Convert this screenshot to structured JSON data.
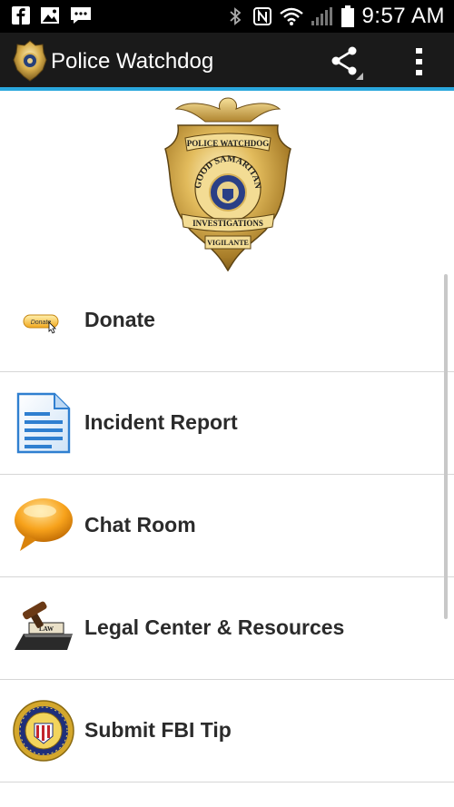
{
  "status_bar": {
    "time": "9:57 AM",
    "left_icons": [
      "facebook-icon",
      "gallery-icon",
      "chat-notification-icon"
    ],
    "right_icons": [
      "bluetooth-icon",
      "nfc-icon",
      "wifi-icon",
      "cell-signal-icon",
      "battery-icon"
    ]
  },
  "action_bar": {
    "title": "Police Watchdog",
    "share_icon": "share-icon",
    "overflow_icon": "overflow-menu-icon",
    "accent_color": "#2aa7dd"
  },
  "badge": {
    "top_text": "POLICE WATCHDOG",
    "arc_text": "GOOD SAMARITAN",
    "banner_text": "INVESTIGATIONS",
    "bottom_text": "VIGILANTE"
  },
  "menu": {
    "items": [
      {
        "label": "Donate",
        "icon": "donate-button-icon",
        "icon_text": "Donate"
      },
      {
        "label": "Incident Report",
        "icon": "document-icon"
      },
      {
        "label": "Chat Room",
        "icon": "speech-bubble-icon"
      },
      {
        "label": "Legal Center & Resources",
        "icon": "gavel-icon",
        "icon_text": "LAW"
      },
      {
        "label": "Submit FBI Tip",
        "icon": "fbi-seal-icon"
      }
    ]
  }
}
